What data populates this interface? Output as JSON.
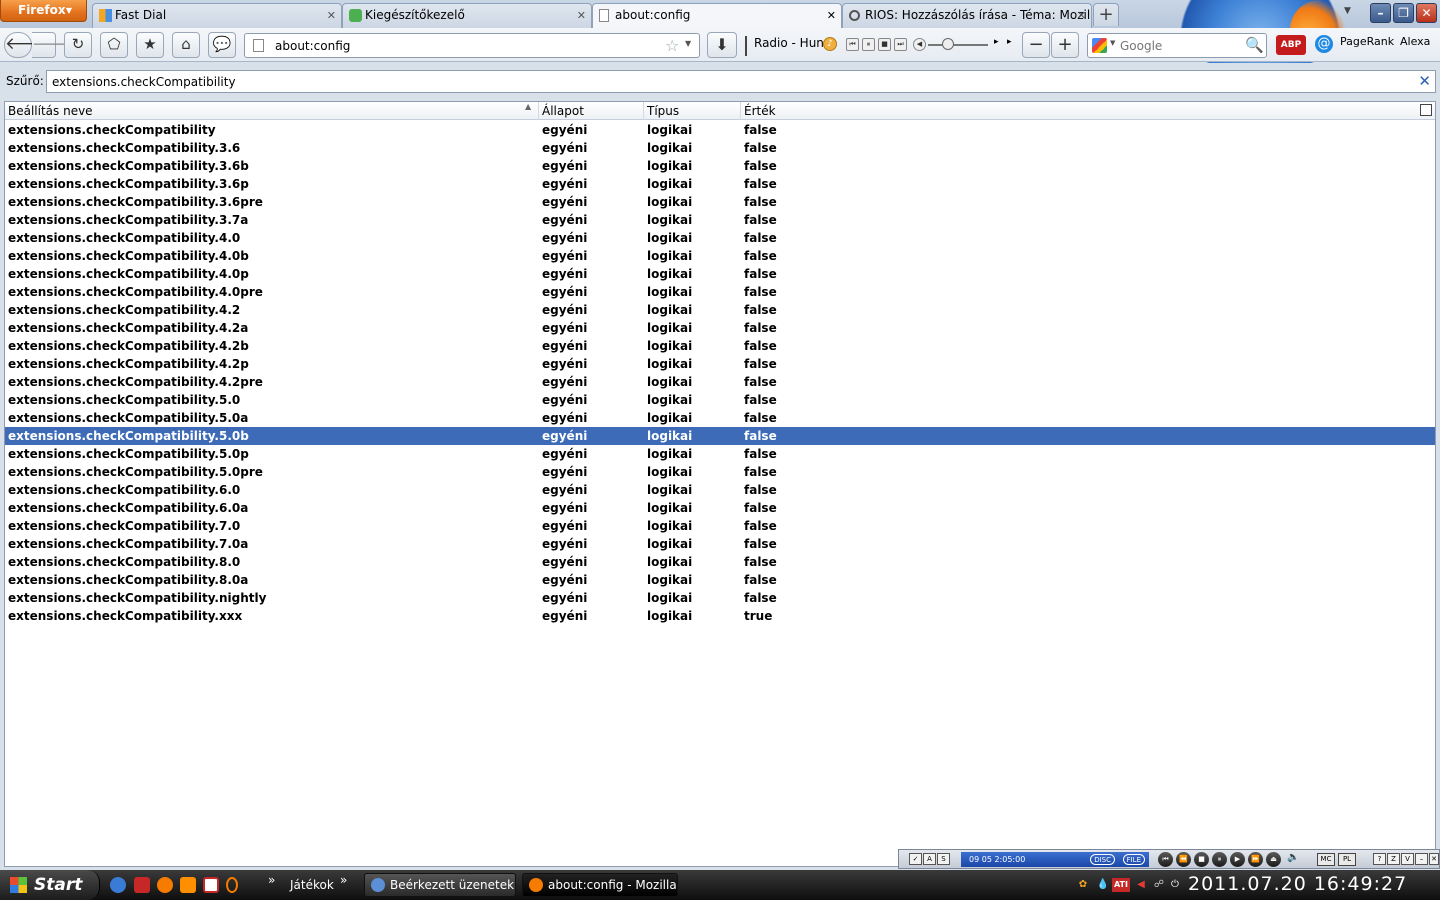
{
  "browser": {
    "menu_button": "Firefox",
    "tabs": [
      {
        "label": "Fast Dial",
        "active": false
      },
      {
        "label": "Kiegészítőkezelő",
        "active": false
      },
      {
        "label": "about:config",
        "active": true
      },
      {
        "label": "RIOS: Hozzászólás írása - Téma: Mozilla ...",
        "active": false
      }
    ],
    "new_tab": "+",
    "url": "about:config",
    "radio_label": "Radio - Hun",
    "search_placeholder": "Google",
    "pagerank": "PageRank",
    "alexa": "Alexa"
  },
  "filter": {
    "label": "Szűrő:",
    "value": "extensions.checkCompatibility"
  },
  "table": {
    "columns": [
      "Beállítás neve",
      "Állapot",
      "Típus",
      "Érték"
    ],
    "selected_index": 17,
    "rows": [
      [
        "extensions.checkCompatibility",
        "egyéni",
        "logikai",
        "false"
      ],
      [
        "extensions.checkCompatibility.3.6",
        "egyéni",
        "logikai",
        "false"
      ],
      [
        "extensions.checkCompatibility.3.6b",
        "egyéni",
        "logikai",
        "false"
      ],
      [
        "extensions.checkCompatibility.3.6p",
        "egyéni",
        "logikai",
        "false"
      ],
      [
        "extensions.checkCompatibility.3.6pre",
        "egyéni",
        "logikai",
        "false"
      ],
      [
        "extensions.checkCompatibility.3.7a",
        "egyéni",
        "logikai",
        "false"
      ],
      [
        "extensions.checkCompatibility.4.0",
        "egyéni",
        "logikai",
        "false"
      ],
      [
        "extensions.checkCompatibility.4.0b",
        "egyéni",
        "logikai",
        "false"
      ],
      [
        "extensions.checkCompatibility.4.0p",
        "egyéni",
        "logikai",
        "false"
      ],
      [
        "extensions.checkCompatibility.4.0pre",
        "egyéni",
        "logikai",
        "false"
      ],
      [
        "extensions.checkCompatibility.4.2",
        "egyéni",
        "logikai",
        "false"
      ],
      [
        "extensions.checkCompatibility.4.2a",
        "egyéni",
        "logikai",
        "false"
      ],
      [
        "extensions.checkCompatibility.4.2b",
        "egyéni",
        "logikai",
        "false"
      ],
      [
        "extensions.checkCompatibility.4.2p",
        "egyéni",
        "logikai",
        "false"
      ],
      [
        "extensions.checkCompatibility.4.2pre",
        "egyéni",
        "logikai",
        "false"
      ],
      [
        "extensions.checkCompatibility.5.0",
        "egyéni",
        "logikai",
        "false"
      ],
      [
        "extensions.checkCompatibility.5.0a",
        "egyéni",
        "logikai",
        "false"
      ],
      [
        "extensions.checkCompatibility.5.0b",
        "egyéni",
        "logikai",
        "false"
      ],
      [
        "extensions.checkCompatibility.5.0p",
        "egyéni",
        "logikai",
        "false"
      ],
      [
        "extensions.checkCompatibility.5.0pre",
        "egyéni",
        "logikai",
        "false"
      ],
      [
        "extensions.checkCompatibility.6.0",
        "egyéni",
        "logikai",
        "false"
      ],
      [
        "extensions.checkCompatibility.6.0a",
        "egyéni",
        "logikai",
        "false"
      ],
      [
        "extensions.checkCompatibility.7.0",
        "egyéni",
        "logikai",
        "false"
      ],
      [
        "extensions.checkCompatibility.7.0a",
        "egyéni",
        "logikai",
        "false"
      ],
      [
        "extensions.checkCompatibility.8.0",
        "egyéni",
        "logikai",
        "false"
      ],
      [
        "extensions.checkCompatibility.8.0a",
        "egyéni",
        "logikai",
        "false"
      ],
      [
        "extensions.checkCompatibility.nightly",
        "egyéni",
        "logikai",
        "false"
      ],
      [
        "extensions.checkCompatibility.xxx",
        "egyéni",
        "logikai",
        "true"
      ]
    ]
  },
  "media_player": {
    "display": "09  05  2:05:00",
    "disc": "DISC",
    "file": "FILE",
    "mc": "MC",
    "pl": "PL"
  },
  "taskbar": {
    "start": "Start",
    "quicklaunch_group": "Játékok",
    "tasks": [
      {
        "label": "Beérkezett üzenetek ...",
        "active": false
      },
      {
        "label": "about:config - Mozilla...",
        "active": true
      }
    ],
    "clock": "2011.07.20 16:49:27"
  },
  "colors": {
    "selection": "#3d6bb8",
    "firefox_button": "#e3721e"
  }
}
